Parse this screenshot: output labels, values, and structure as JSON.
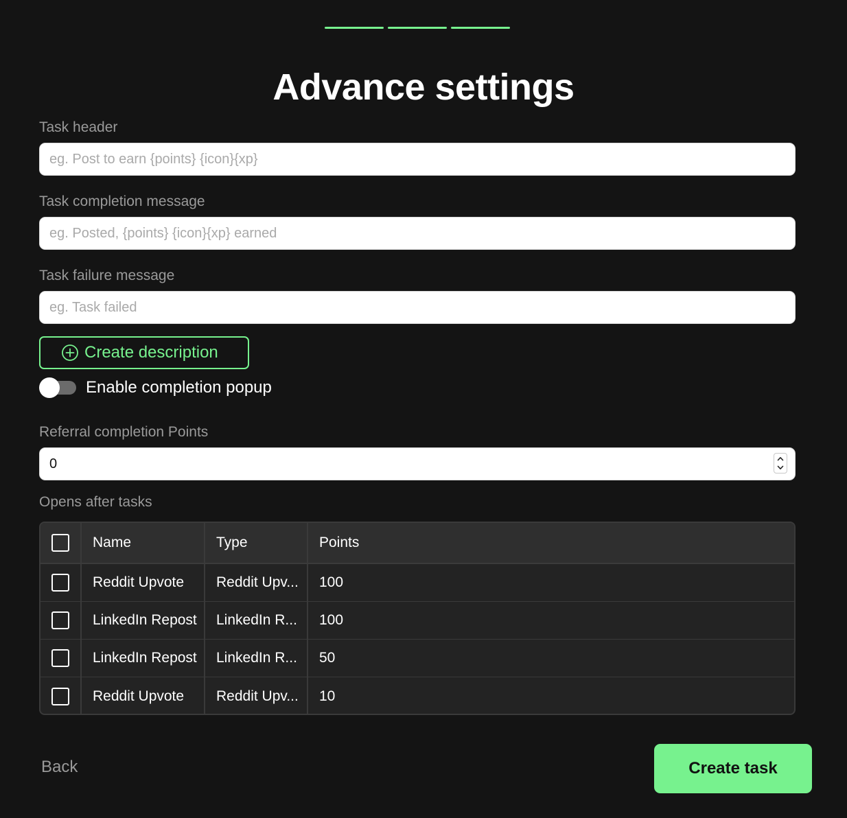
{
  "colors": {
    "accent": "#77f28e",
    "background": "#141414",
    "muted_text": "#9a9a9a"
  },
  "stepper": {
    "steps": 3,
    "completed": 3
  },
  "title": "Advance settings",
  "fields": {
    "task_header": {
      "label": "Task header",
      "placeholder": "eg. Post to earn {points} {icon}{xp}",
      "value": ""
    },
    "completion_message": {
      "label": "Task completion message",
      "placeholder": "eg. Posted, {points} {icon}{xp} earned",
      "value": ""
    },
    "failure_message": {
      "label": "Task failure message",
      "placeholder": "eg. Task failed",
      "value": ""
    }
  },
  "create_description_label": "Create description",
  "popup_toggle": {
    "label": "Enable completion popup",
    "enabled": false
  },
  "referral_points": {
    "label": "Referral completion Points",
    "value": "0"
  },
  "opens_after": {
    "label": "Opens after tasks",
    "columns": [
      "Name",
      "Type",
      "Points"
    ],
    "rows": [
      {
        "name": "Reddit Upvote",
        "type": "Reddit Upv...",
        "points": "100"
      },
      {
        "name": "LinkedIn Repost",
        "type": "LinkedIn R...",
        "points": "100"
      },
      {
        "name": "LinkedIn Repost",
        "type": "LinkedIn R...",
        "points": "50"
      },
      {
        "name": "Reddit Upvote",
        "type": "Reddit Upv...",
        "points": "10"
      }
    ]
  },
  "footer": {
    "back_label": "Back",
    "create_label": "Create task"
  }
}
